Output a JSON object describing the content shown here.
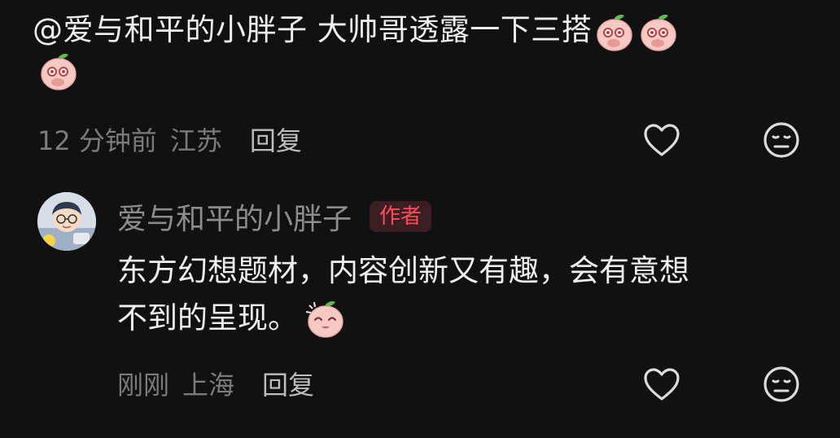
{
  "top_comment": {
    "text": "@爱与和平的小胖子 大帅哥透露一下三搭",
    "emojis": [
      "shy-peach-emoji",
      "shy-peach-emoji",
      "shy-peach-emoji"
    ],
    "time": "12 分钟前",
    "location": "江苏",
    "reply_label": "回复"
  },
  "reply_comment": {
    "author": "爱与和平的小胖子",
    "badge": "作者",
    "text_line1": "东方幻想题材，内容创新又有趣，会有意想",
    "text_line2": "不到的呈现。",
    "emoji": "happy-peach-emoji",
    "time": "刚刚",
    "location": "上海",
    "reply_label": "回复"
  },
  "icons": {
    "like": "heart-outline-icon",
    "dislike": "meh-face-icon"
  },
  "colors": {
    "background": "#111111",
    "text": "#efefef",
    "meta": "#7b7b7b",
    "badge_text": "#ff4a5e",
    "badge_bg": "#3a1e22"
  }
}
